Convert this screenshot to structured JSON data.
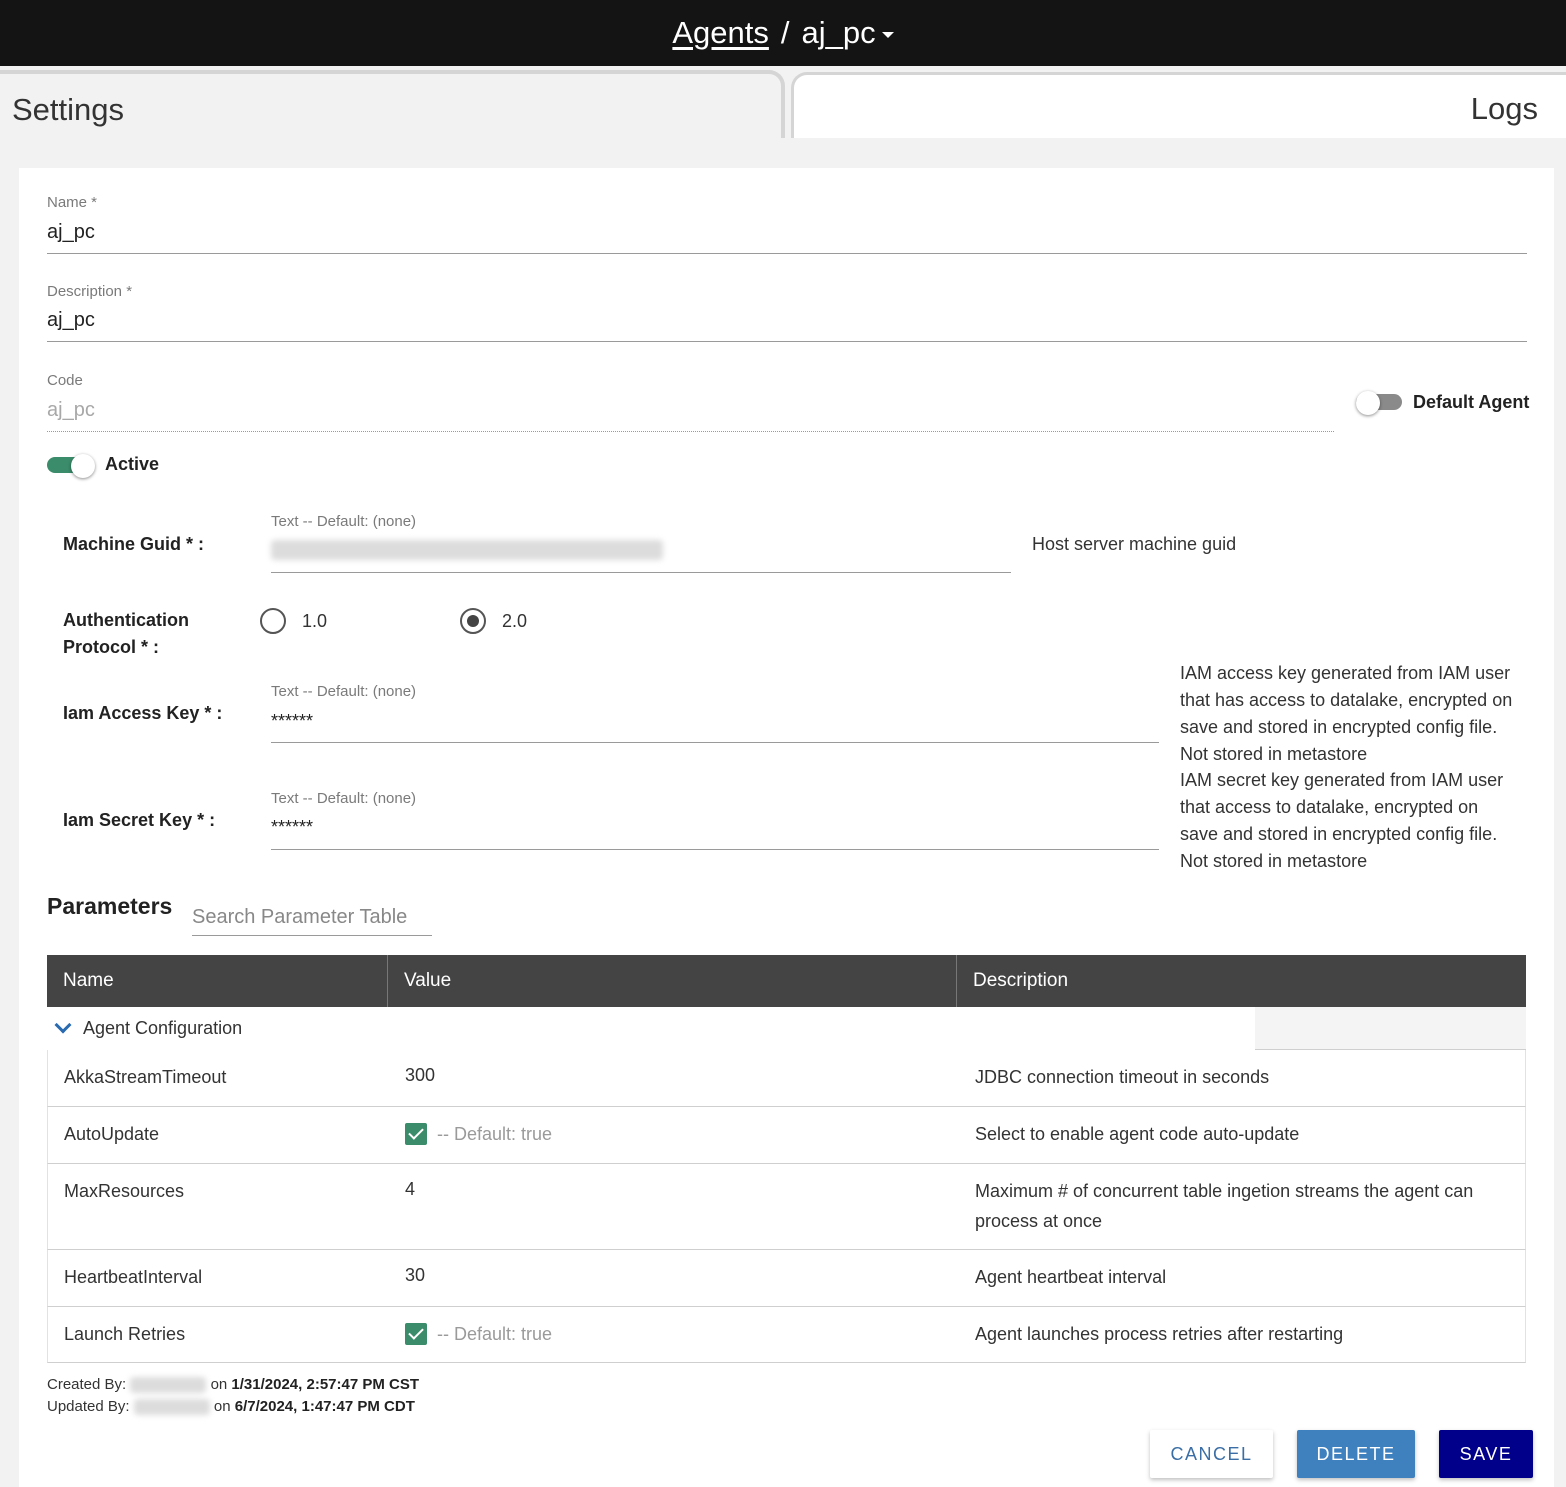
{
  "header": {
    "crumb_root": "Agents",
    "separator": "/",
    "current": "aj_pc"
  },
  "tabs": [
    {
      "label": "Settings"
    },
    {
      "label": "Logs"
    }
  ],
  "form": {
    "name": {
      "label": "Name *",
      "value": "aj_pc"
    },
    "description": {
      "label": "Description *",
      "value": "aj_pc"
    },
    "code": {
      "label": "Code",
      "value": "aj_pc"
    },
    "default_agent": {
      "label": "Default Agent",
      "on": false
    },
    "active": {
      "label": "Active",
      "on": true
    },
    "machine_guid": {
      "label": "Machine Guid * :",
      "hint": "Text -- Default: (none)",
      "help": "Host server machine guid"
    },
    "auth_protocol": {
      "label_line1": "Authentication",
      "label_line2": "Protocol * :",
      "options": [
        "1.0",
        "2.0"
      ],
      "selected": "2.0"
    },
    "iam_access_key": {
      "label": "Iam Access Key * :",
      "hint": "Text -- Default: (none)",
      "value": "******",
      "help": [
        "IAM access key generated from IAM user",
        "that has access to datalake, encrypted on",
        "save and stored in encrypted config file.",
        "Not stored in metastore"
      ]
    },
    "iam_secret_key": {
      "label": "Iam Secret Key * :",
      "hint": "Text -- Default: (none)",
      "value": "******",
      "help": [
        "IAM secret key generated from IAM user",
        "that access to datalake, encrypted on",
        "save and stored in encrypted config file.",
        "Not stored in metastore"
      ]
    }
  },
  "parameters": {
    "title": "Parameters",
    "search_placeholder": "Search Parameter Table",
    "columns": [
      "Name",
      "Value",
      "Description"
    ],
    "group": "Agent Configuration",
    "rows": [
      {
        "name": "AkkaStreamTimeout",
        "value": "300",
        "description": "JDBC connection timeout in seconds"
      },
      {
        "name": "AutoUpdate",
        "value": "",
        "checked": true,
        "default_hint": "-- Default: true",
        "description": "Select to enable agent code auto-update"
      },
      {
        "name": "MaxResources",
        "value": "4",
        "description_line1": "Maximum # of concurrent table ingetion streams the agent can",
        "description_line2": "process at once"
      },
      {
        "name": "HeartbeatInterval",
        "value": "30",
        "description": "Agent heartbeat interval"
      },
      {
        "name": "Launch Retries",
        "value": "",
        "checked": true,
        "default_hint": "-- Default: true",
        "description": "Agent launches process retries after restarting"
      }
    ]
  },
  "audit": {
    "created_label": "Created By:",
    "created_on": "on",
    "created_at": "1/31/2024, 2:57:47 PM CST",
    "updated_label": "Updated By:",
    "updated_on": "on",
    "updated_at": "6/7/2024, 1:47:47 PM CDT"
  },
  "actions": {
    "cancel": "CANCEL",
    "delete": "DELETE",
    "save": "SAVE"
  },
  "colors": {
    "topbar": "#141414",
    "toggle_on": "#3a8c6a",
    "save": "#00008b",
    "delete": "#3f80bf",
    "table_header": "#444444"
  }
}
